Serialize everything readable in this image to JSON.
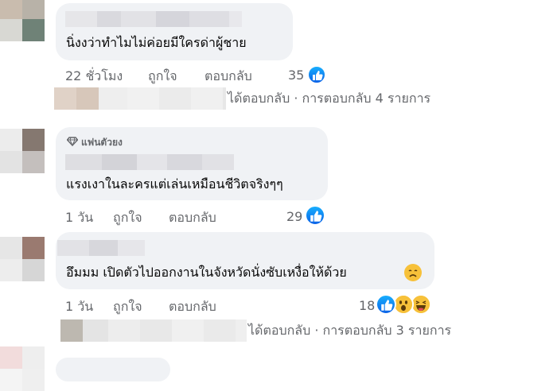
{
  "comments": [
    {
      "text": "นิ่งงว่าทำไมไม่ค่อยมีใครด่าผู้ชาย",
      "time": "22 ชั่วโมง",
      "like_label": "ถูกใจ",
      "reply_label": "ตอบกลับ",
      "reaction_count": "35",
      "reactions": [
        "like-icon"
      ],
      "replies_summary": "ได้ตอบกลับ · การตอบกลับ 4 รายการ"
    },
    {
      "badge": "แฟนตัวยง",
      "text": "แรงเงาในละครแต่เล่นเหมือนชีวิตจริงๆๆ",
      "time": "1 วัน",
      "like_label": "ถูกใจ",
      "reply_label": "ตอบกลับ",
      "reaction_count": "29",
      "reactions": [
        "like-icon"
      ]
    },
    {
      "text": "อึมมม เปิดตัวไปออกงานในจังหวัดนั่งซับเหงื่อให้ด้วย",
      "time": "1 วัน",
      "like_label": "ถูกใจ",
      "reply_label": "ตอบกลับ",
      "reaction_count": "18",
      "reactions": [
        "like-icon",
        "wow-icon",
        "haha-icon"
      ],
      "replies_summary": "ได้ตอบกลับ · การตอบกลับ 3 รายการ"
    }
  ],
  "colors": {
    "bubble": "#f0f2f5",
    "meta_text": "#65676b",
    "like_blue": "#0866ff"
  }
}
